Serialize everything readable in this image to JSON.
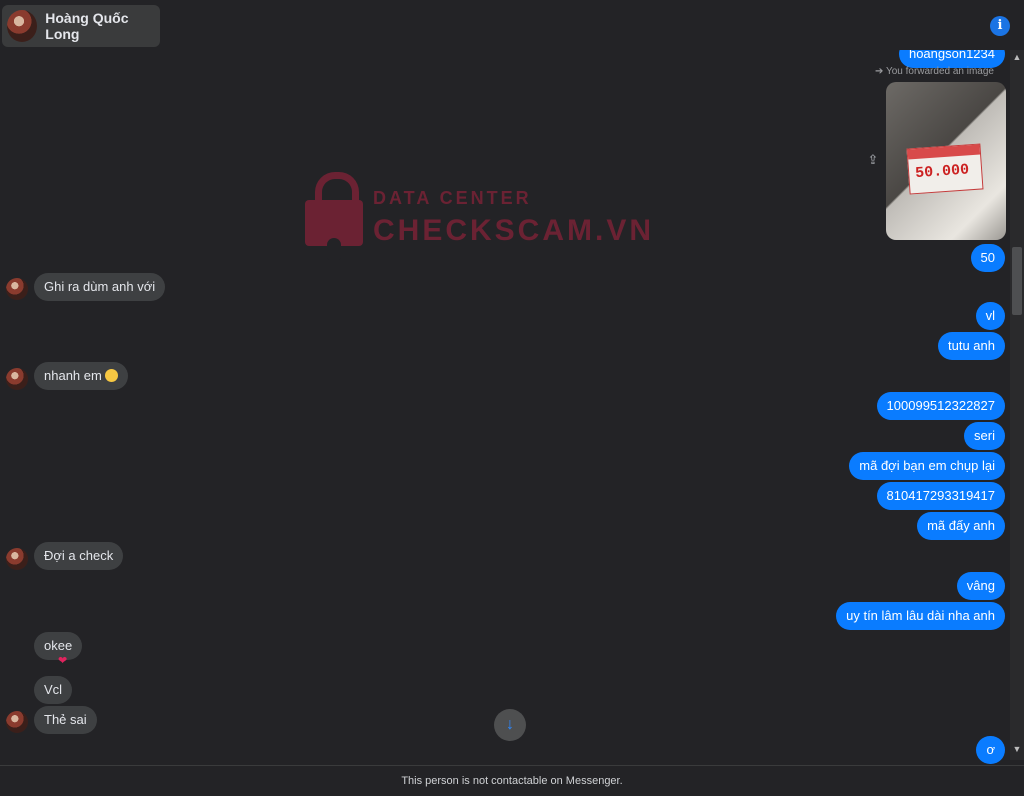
{
  "header": {
    "contact_name": "Hoàng Quốc Long",
    "info_icon": "info-icon",
    "info_glyph": "i"
  },
  "watermark": {
    "line1": "DATA CENTER",
    "line2": "CHECKSCAM.VN",
    "color": "#6b2233"
  },
  "forward_note": "You forwarded an image",
  "forwarded_image": {
    "card_digits": "50.000"
  },
  "messages": [
    {
      "id": "m0",
      "side": "out",
      "text": "hoangson1234",
      "partially_visible": true
    },
    {
      "id": "m1",
      "side": "out",
      "text": "50"
    },
    {
      "id": "m2",
      "side": "in",
      "text": "Ghi ra dùm anh với"
    },
    {
      "id": "m3",
      "side": "out",
      "text": "vl"
    },
    {
      "id": "m4",
      "side": "out",
      "text": "tutu anh"
    },
    {
      "id": "m5",
      "side": "in",
      "text": "nhanh em"
    },
    {
      "id": "m6",
      "side": "out",
      "text": "100099512322827"
    },
    {
      "id": "m7",
      "side": "out",
      "text": "seri"
    },
    {
      "id": "m8",
      "side": "out",
      "text": "mã đợi bạn em chụp lại"
    },
    {
      "id": "m9",
      "side": "out",
      "text": "810417293319417"
    },
    {
      "id": "m10",
      "side": "out",
      "text": "mã đấy anh"
    },
    {
      "id": "m11",
      "side": "in",
      "text": "Đợi a check"
    },
    {
      "id": "m12",
      "side": "out",
      "text": "vâng"
    },
    {
      "id": "m13",
      "side": "out",
      "text": "uy tín lâm lâu dài nha anh"
    },
    {
      "id": "m14",
      "side": "in",
      "text": "okee"
    },
    {
      "id": "m15",
      "side": "in",
      "text": "Vcl"
    },
    {
      "id": "m16",
      "side": "in",
      "text": "Thẻ sai"
    },
    {
      "id": "m17",
      "side": "out",
      "text": "ơ"
    }
  ],
  "reaction_glyph": "❤",
  "jump_to_latest_glyph": "↓",
  "share_glyph": "⇪",
  "footer_text": "This person is not contactable on Messenger.",
  "colors": {
    "outgoing_bubble": "#0a7cff",
    "incoming_bubble": "#3e4042",
    "background": "#232326"
  }
}
